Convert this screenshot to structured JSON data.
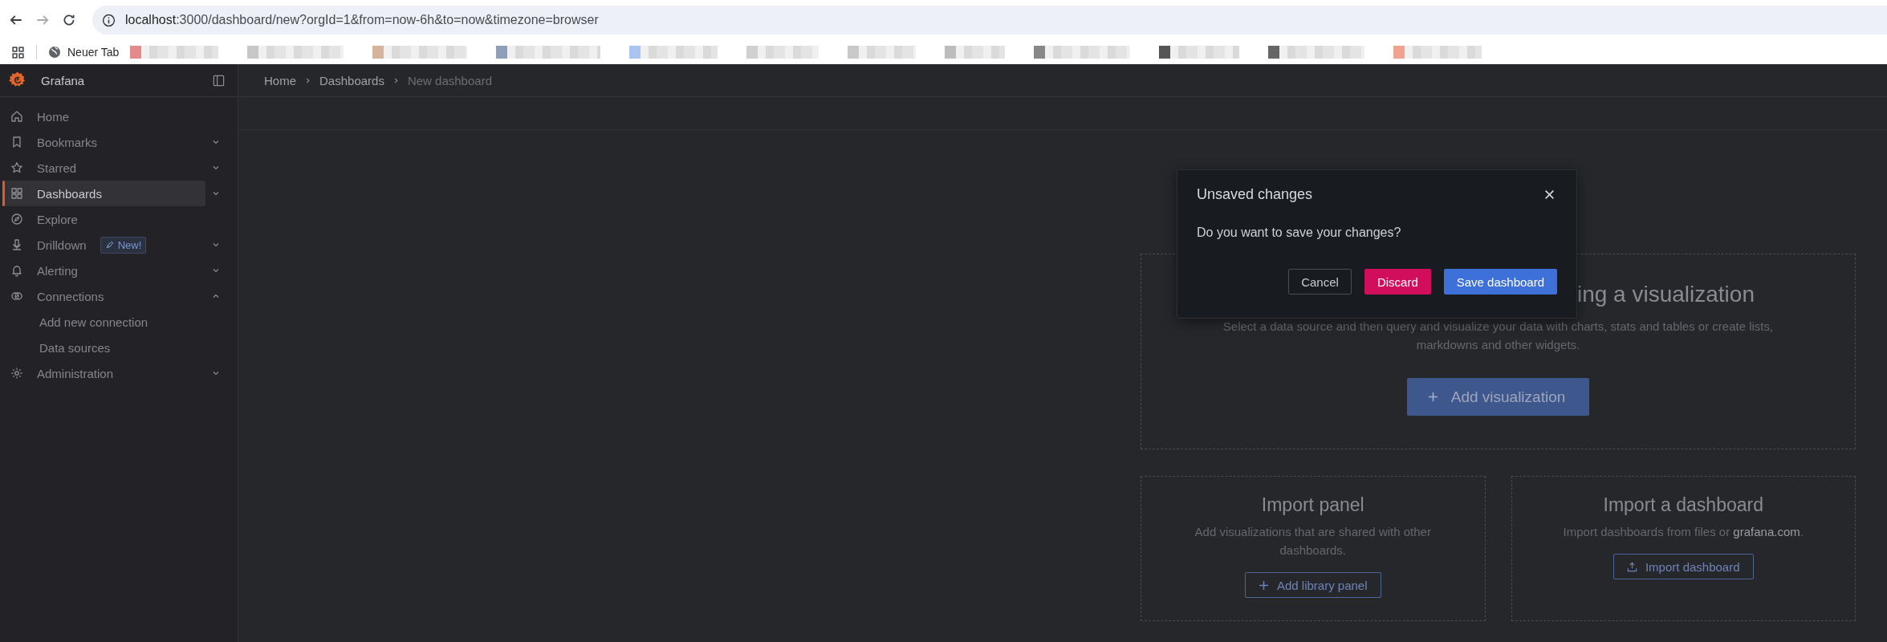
{
  "browser": {
    "url_host": "localhost",
    "url_rest": ":3000/dashboard/new?orgId=1&from=now-6h&to=now&timezone=browser",
    "forward_disabled": true,
    "bookmarks": [
      {
        "label": "Neuer Tab"
      }
    ]
  },
  "app": {
    "title": "Grafana"
  },
  "breadcrumbs": [
    {
      "label": "Home",
      "current": false
    },
    {
      "label": "Dashboards",
      "current": false
    },
    {
      "label": "New dashboard",
      "current": true
    }
  ],
  "nav": [
    {
      "label": "Home",
      "selected": false
    },
    {
      "label": "Bookmarks",
      "selected": false,
      "expanded": false
    },
    {
      "label": "Starred",
      "selected": false,
      "expanded": false
    },
    {
      "label": "Dashboards",
      "selected": true,
      "expanded": false
    },
    {
      "label": "Explore",
      "selected": false
    },
    {
      "label": "Drilldown",
      "selected": false,
      "expanded": false,
      "badge": "New!"
    },
    {
      "label": "Alerting",
      "selected": false,
      "expanded": false
    },
    {
      "label": "Connections",
      "selected": false,
      "expanded": true,
      "children": [
        {
          "label": "Add new connection",
          "selected": false
        },
        {
          "label": "Data sources",
          "selected": false
        }
      ]
    },
    {
      "label": "Administration",
      "selected": false,
      "expanded": false
    }
  ],
  "hero": {
    "title_visible": "ing a visualization",
    "description": "Select a data source and then query and visualize your data with charts, stats and tables or create lists, markdowns and other widgets.",
    "button": "Add visualization"
  },
  "cards": [
    {
      "title": "Import panel",
      "description": "Add visualizations that are shared with other dashboards.",
      "button": "Add library panel"
    },
    {
      "title": "Import a dashboard",
      "description_before": "Import dashboards from files or ",
      "link": "grafana.com",
      "description_after": ".",
      "button": "Import dashboard"
    }
  ],
  "modal": {
    "title": "Unsaved changes",
    "message": "Do you want to save your changes?",
    "buttons": [
      {
        "label": "Cancel",
        "kind": "secondary"
      },
      {
        "label": "Discard",
        "kind": "destructive"
      },
      {
        "label": "Save dashboard",
        "kind": "primary"
      }
    ]
  }
}
